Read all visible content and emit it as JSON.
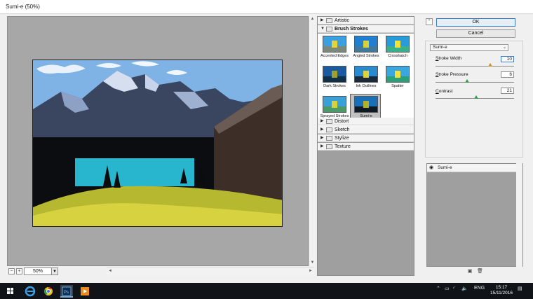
{
  "window": {
    "title": "Sumi-e (50%)"
  },
  "preview": {
    "zoom": "50%",
    "zoom_out": "−",
    "zoom_in": "+",
    "scroll_up": "▲",
    "scroll_down": "▼",
    "scroll_left": "◄",
    "scroll_right": "►"
  },
  "gallery": {
    "categories": [
      {
        "label": "Artistic",
        "expanded": false
      },
      {
        "label": "Brush Strokes",
        "expanded": true
      },
      {
        "label": "Distort",
        "expanded": false
      },
      {
        "label": "Sketch",
        "expanded": false
      },
      {
        "label": "Stylize",
        "expanded": false
      },
      {
        "label": "Texture",
        "expanded": false
      }
    ],
    "filters": [
      {
        "label": "Accented Edges"
      },
      {
        "label": "Angled Strokes"
      },
      {
        "label": "Crosshatch"
      },
      {
        "label": "Dark Strokes"
      },
      {
        "label": "Ink Outlines"
      },
      {
        "label": "Spatter"
      },
      {
        "label": "Sprayed Strokes"
      },
      {
        "label": "Sumi-e"
      }
    ],
    "selected_filter": "Sumi-e"
  },
  "buttons": {
    "ok": "OK",
    "cancel": "Cancel",
    "collapse": "⌃"
  },
  "settings": {
    "filter": "Sumi-e",
    "params": [
      {
        "label_key": "S",
        "label_rest": "troke Width",
        "value": "10",
        "fraction": 0.7
      },
      {
        "label_key": "S",
        "label_rest": "troke Pressure",
        "value": "6",
        "fraction": 0.4
      },
      {
        "label_key": "C",
        "label_rest": "ontrast",
        "value": "21",
        "fraction": 0.52
      }
    ]
  },
  "layers": {
    "items": [
      {
        "label": "Sumi-e"
      }
    ]
  },
  "taskbar": {
    "language": "ENG",
    "time": "15:17",
    "date": "15/11/2016"
  },
  "colors": {
    "accent": "#3a78c8",
    "slider_thumb": "#c8922a",
    "slider_thumb_2": "#3a9a4a"
  }
}
